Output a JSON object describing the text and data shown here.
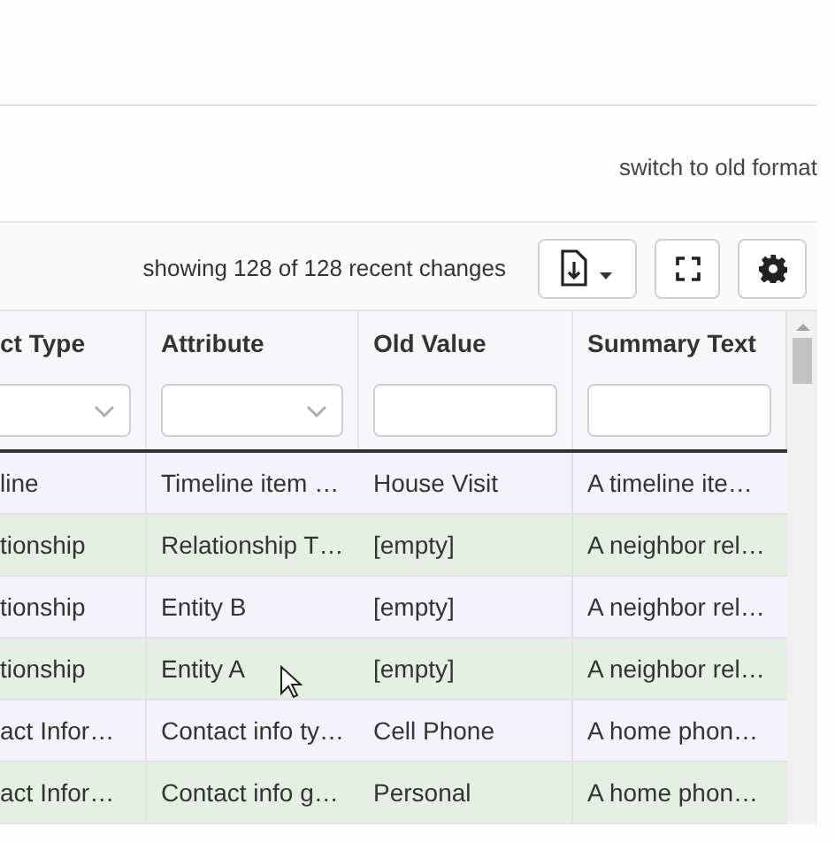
{
  "header_link": "switch to old format",
  "toolbar": {
    "count_text": "showing 128 of 128 recent changes"
  },
  "table": {
    "columns": [
      {
        "label": "ct Type",
        "kind": "select"
      },
      {
        "label": "Attribute",
        "kind": "select"
      },
      {
        "label": "Old Value",
        "kind": "text"
      },
      {
        "label": "Summary Text",
        "kind": "text"
      }
    ],
    "rows": [
      [
        "line",
        "Timeline item …",
        "House Visit",
        "A timeline ite…"
      ],
      [
        "tionship",
        "Relationship T…",
        "[empty]",
        "A neighbor rel…"
      ],
      [
        "tionship",
        "Entity B",
        "[empty]",
        "A neighbor rel…"
      ],
      [
        "tionship",
        "Entity A",
        "[empty]",
        "A neighbor rel…"
      ],
      [
        "act Infor…",
        "Contact info ty…",
        "Cell Phone",
        "A home phon…"
      ],
      [
        "act Infor…",
        "Contact info g…",
        "Personal",
        "A home phon…"
      ]
    ]
  }
}
